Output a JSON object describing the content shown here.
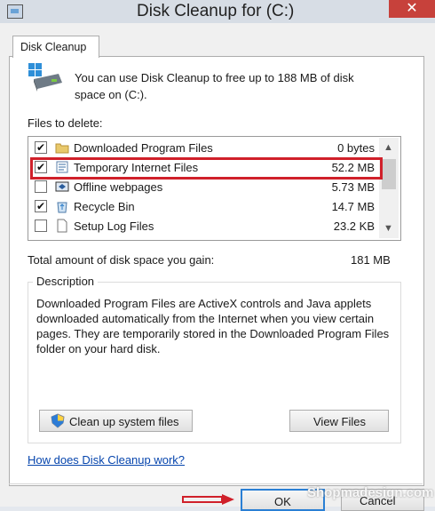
{
  "window": {
    "title": "Disk Cleanup for  (C:)",
    "close_glyph": "✕"
  },
  "tab": {
    "label": "Disk Cleanup"
  },
  "intro": "You can use Disk Cleanup to free up to 188 MB of disk space on  (C:).",
  "files_label": "Files to delete:",
  "files": [
    {
      "name": "Downloaded Program Files",
      "size": "0 bytes",
      "checked": true,
      "icon": "folder-icon"
    },
    {
      "name": "Temporary Internet Files",
      "size": "52.2 MB",
      "checked": true,
      "icon": "internet-files-icon"
    },
    {
      "name": "Offline webpages",
      "size": "5.73 MB",
      "checked": false,
      "icon": "offline-webpages-icon"
    },
    {
      "name": "Recycle Bin",
      "size": "14.7 MB",
      "checked": true,
      "icon": "recycle-bin-icon"
    },
    {
      "name": "Setup Log Files",
      "size": "23.2 KB",
      "checked": false,
      "icon": "file-icon"
    }
  ],
  "total": {
    "label": "Total amount of disk space you gain:",
    "value": "181 MB"
  },
  "description": {
    "legend": "Description",
    "text": "Downloaded Program Files are ActiveX controls and Java applets downloaded automatically from the Internet when you view certain pages. They are temporarily stored in the Downloaded Program Files folder on your hard disk."
  },
  "buttons": {
    "cleanup_system": "Clean up system files",
    "view_files": "View Files",
    "ok": "OK",
    "cancel": "Cancel"
  },
  "help_link": "How does Disk Cleanup work?",
  "watermark": "Shopmadesign.com",
  "colors": {
    "highlight": "#d0202a",
    "close": "#c7413b",
    "link": "#0645ad"
  }
}
